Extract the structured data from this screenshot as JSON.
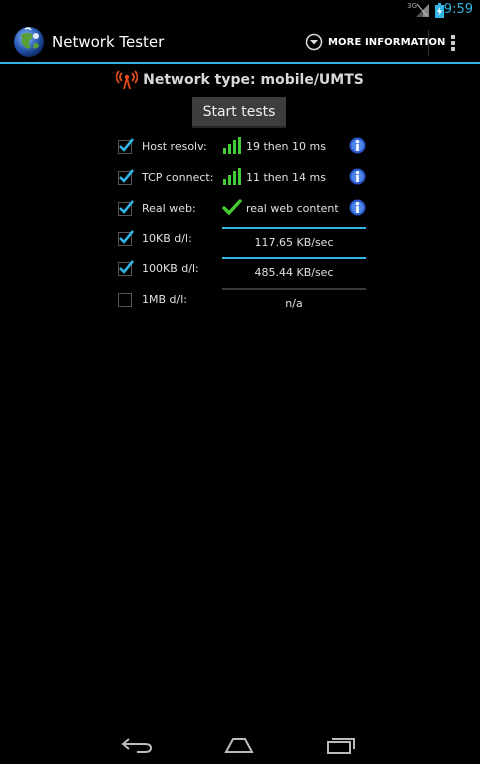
{
  "status_bar": {
    "network_label": "3G",
    "time": "9:59"
  },
  "action_bar": {
    "title": "Network Tester",
    "more_info_label": "MORE INFORMATION"
  },
  "network": {
    "type_text": "Network type: mobile/UMTS"
  },
  "start_button": {
    "label": "Start tests"
  },
  "tests": [
    {
      "label": "Host resolv:",
      "checked": true,
      "result_icon": "signal-bars-icon",
      "value": "19 then 10 ms",
      "has_info": true
    },
    {
      "label": "TCP connect:",
      "checked": true,
      "result_icon": "signal-bars-icon",
      "value": "11 then 14 ms",
      "has_info": true
    },
    {
      "label": "Real web:",
      "checked": true,
      "result_icon": "check-icon",
      "value": "real web content",
      "has_info": true
    },
    {
      "label": "10KB d/l:",
      "checked": true,
      "value": "117.65 KB/sec"
    },
    {
      "label": "100KB d/l:",
      "checked": true,
      "value": "485.44 KB/sec"
    },
    {
      "label": "1MB d/l:",
      "checked": false,
      "value": "n/a"
    }
  ],
  "colors": {
    "accent": "#33b5e5",
    "good": "#44cc33",
    "info": "#2a56c8"
  }
}
